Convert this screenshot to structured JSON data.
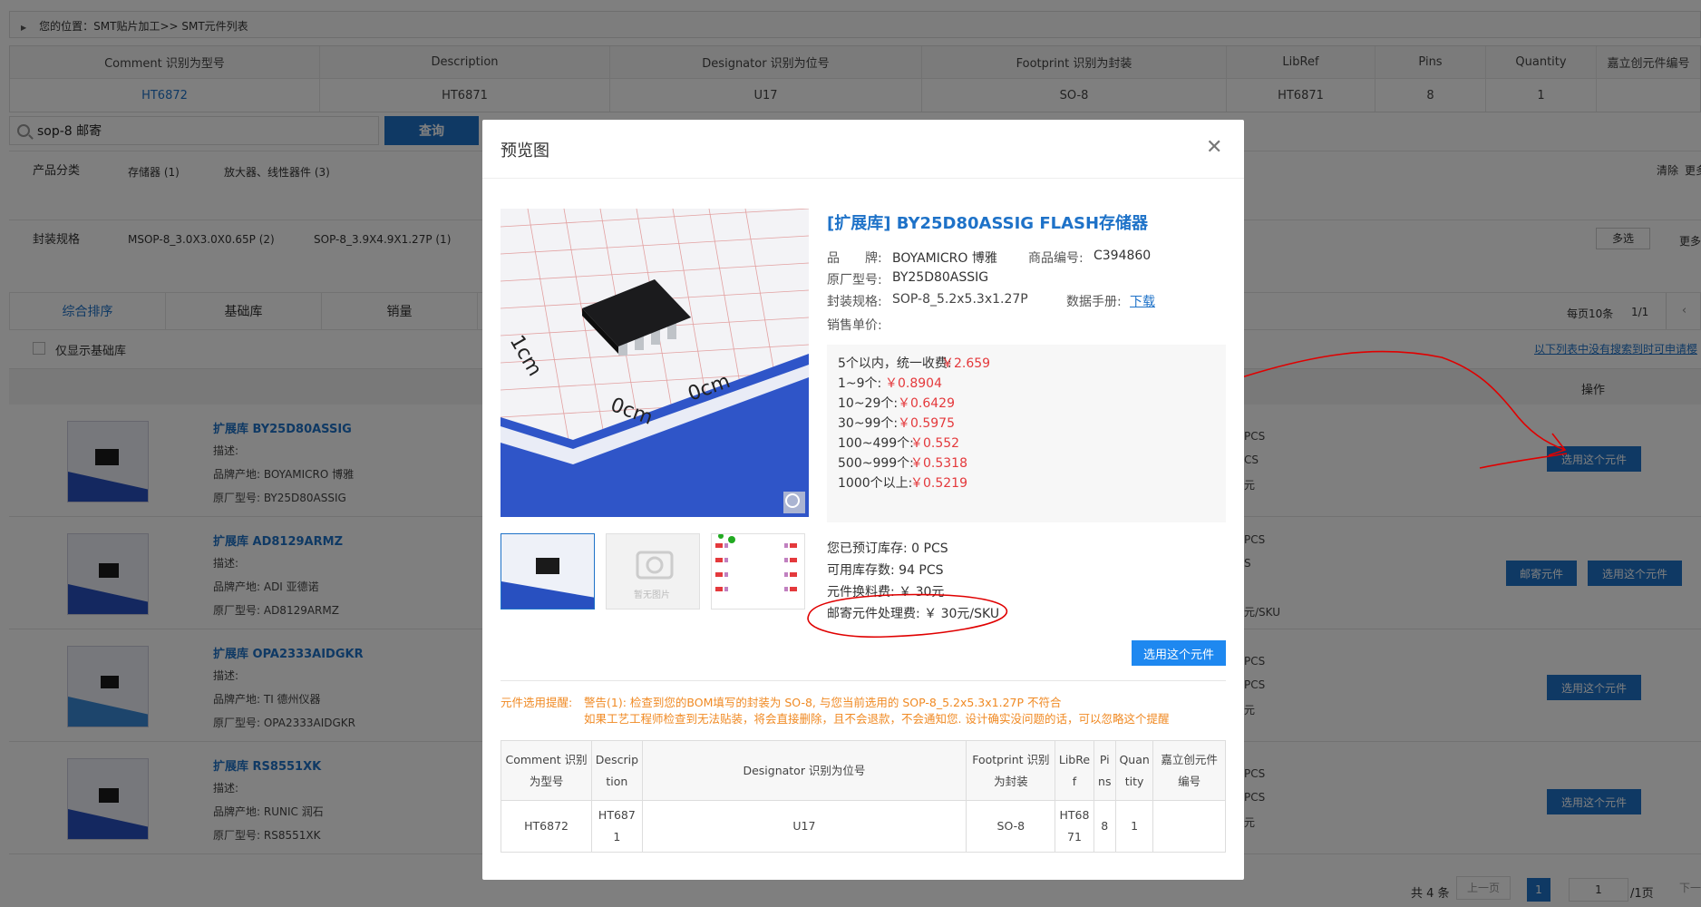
{
  "breadcrumb": "您的位置：SMT贴片加工>> SMT元件列表",
  "bom": {
    "headers": [
      "Comment 识别为型号",
      "Description",
      "Designator 识别为位号",
      "Footprint 识别为封装",
      "LibRef",
      "Pins",
      "Quantity",
      "嘉立创元件编号"
    ],
    "row": [
      "HT6872",
      "HT6871",
      "U17",
      "SO-8",
      "HT6871",
      "8",
      "1",
      ""
    ]
  },
  "search": {
    "value": "sop-8 邮寄",
    "button": "查询"
  },
  "filter": {
    "category_label": "产品分类",
    "categories": [
      "存储器 (1)",
      "放大器、线性器件 (3)"
    ],
    "clear": "清除",
    "more": "更多",
    "package_label": "封装规格",
    "packages": [
      "MSOP-8_3.0X3.0X0.65P (2)",
      "SOP-8_3.9X4.9X1.27P (1)"
    ],
    "multi": "多选",
    "more2": "更多"
  },
  "sort_tabs": [
    "综合排序",
    "基础库",
    "销量"
  ],
  "pager_top": {
    "per_page": "每页10条",
    "page": "1/1"
  },
  "basic_only": "仅显示基础库",
  "notice_link": "以下列表中没有搜索到时可申请樱",
  "op_header": "操作",
  "products": [
    {
      "name": "扩展库 BY25D80ASSIG",
      "desc": "描述:",
      "brand": "品牌产地: BOYAMICRO 博雅",
      "mpn": "原厂型号: BY25D80ASSIG",
      "s1": "PCS",
      "s2": "CS",
      "s3": "元",
      "btn": "选用这个元件"
    },
    {
      "name": "扩展库 AD8129ARMZ",
      "desc": "描述:",
      "brand": "品牌产地: ADI 亚德诺",
      "mpn": "原厂型号: AD8129ARMZ",
      "s1": "PCS",
      "s2": "S",
      "s3": "元/SKU",
      "btn_mail": "邮寄元件",
      "btn": "选用这个元件"
    },
    {
      "name": "扩展库 OPA2333AIDGKR",
      "desc": "描述:",
      "brand": "品牌产地: TI 德州仪器",
      "mpn": "原厂型号: OPA2333AIDGKR",
      "s1": "PCS",
      "s2": "PCS",
      "s3": "元",
      "btn": "选用这个元件"
    },
    {
      "name": "扩展库 RS8551XK",
      "desc": "描述:",
      "brand": "品牌产地: RUNIC 润石",
      "mpn": "原厂型号: RS8551XK",
      "s1": "PCS",
      "s2": "PCS",
      "s3": "元",
      "btn": "选用这个元件"
    }
  ],
  "pager_bottom": {
    "total": "共 4 条",
    "prev": "上一页",
    "current": "1",
    "jump": "1",
    "pages": "/1页",
    "next": "下一"
  },
  "modal": {
    "title": "预览图",
    "product_title": "[扩展库] BY25D80ASSIG FLASH存储器",
    "brand_label": "品　　牌:",
    "brand": "BOYAMICRO 博雅",
    "code_label": "商品编号:",
    "code": "C394860",
    "mpn_label": "原厂型号:",
    "mpn": "BY25D80ASSIG",
    "pkg_label": "封装规格:",
    "pkg": "SOP-8_5.2x5.3x1.27P",
    "ds_label": "数据手册:",
    "ds": "下载",
    "price_label": "销售单价:",
    "prices": [
      {
        "qty": "5个以内，统一收费:",
        "price": "￥2.659"
      },
      {
        "qty": "1~9个:",
        "price": "￥0.8904"
      },
      {
        "qty": "10~29个:",
        "price": "￥0.6429"
      },
      {
        "qty": "30~99个:",
        "price": "￥0.5975"
      },
      {
        "qty": "100~499个:",
        "price": "￥0.552"
      },
      {
        "qty": "500~999个:",
        "price": "￥0.5318"
      },
      {
        "qty": "1000个以上:",
        "price": "￥0.5219"
      }
    ],
    "reserved": "您已预订库存:  0 PCS",
    "available": "可用库存数:  94 PCS",
    "swap_fee": "元件换料费:  ￥ 30元",
    "mail_fee": "邮寄元件处理费:  ￥ 30元/SKU",
    "select_btn": "选用这个元件",
    "no_image": "暂无图片",
    "warn_label": "元件选用提醒:",
    "warn1": "警告(1): 检查到您的BOM填写的封装为 SO-8,  与您当前选用的 SOP-8_5.2x5.3x1.27P 不符合",
    "warn2": "如果工艺工程师检查到无法贴装，将会直接删除，且不会退款，不会通知您. 设计确实没问题的话，可以忽略这个提醒",
    "table_headers": [
      "Comment 识别为型号",
      "Descrip tion",
      "Designator 识别为位号",
      "Footprint 识别为封装",
      "LibRe f",
      "Pi ns",
      "Quan tity",
      "嘉立创元件编号"
    ],
    "table_row": [
      "HT6872",
      "HT687 1",
      "U17",
      "SO-8",
      "HT68 71",
      "8",
      "1",
      ""
    ]
  },
  "colors": {
    "accent": "#1e72c8",
    "price_red": "#e4393c",
    "warn": "#f08a24",
    "annotation": "#e00000"
  }
}
